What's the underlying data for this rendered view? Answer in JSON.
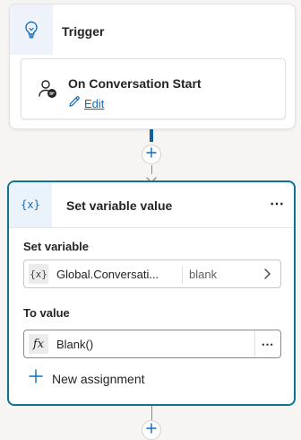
{
  "trigger": {
    "title": "Trigger",
    "icon": "lightbulb-icon",
    "item": {
      "title": "On Conversation Start",
      "icon": "person-chat-icon",
      "edit_label": "Edit"
    }
  },
  "action": {
    "icon_text": "{x}",
    "title": "Set variable value",
    "more_label": "⋯",
    "set_variable_label": "Set variable",
    "variable": {
      "icon_text": "{x}",
      "name": "Global.Conversati...",
      "type": "blank"
    },
    "to_value_label": "To value",
    "value": {
      "icon_text": "fx",
      "text": "Blank()",
      "more_label": "⋯"
    },
    "new_assignment_label": "New assignment"
  },
  "colors": {
    "accent": "#0f6cbd",
    "selected_border": "#0e7490",
    "connector": "#115ea3"
  }
}
